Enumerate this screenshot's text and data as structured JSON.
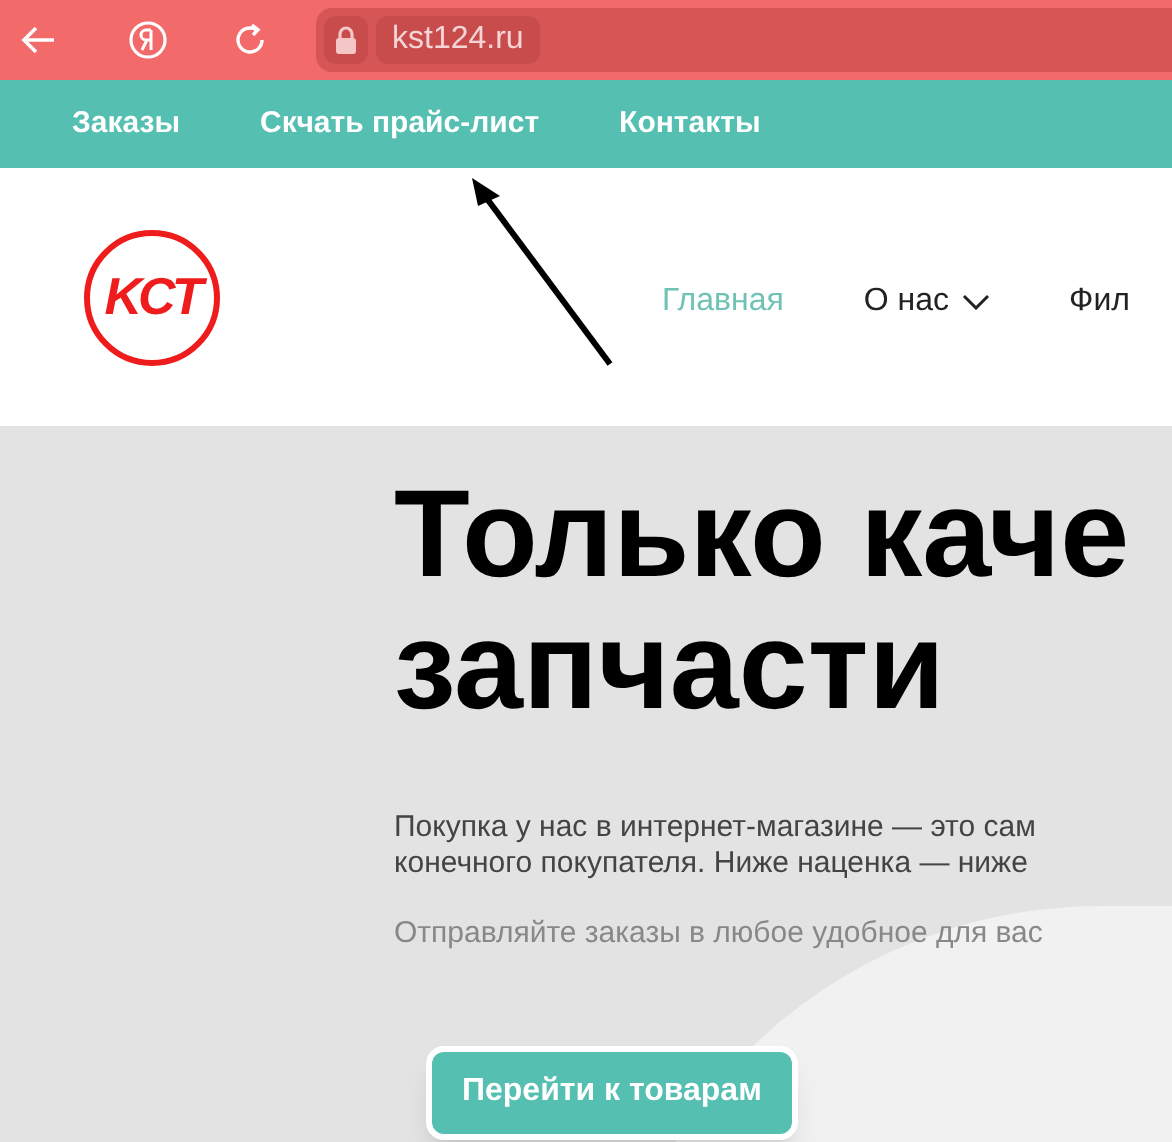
{
  "browser": {
    "url": "kst124.ru"
  },
  "top_nav": [
    "Заказы",
    "Скчать прайс-лист",
    "Контакты"
  ],
  "logo": {
    "text": "KCT"
  },
  "main_nav": [
    {
      "label": "Главная",
      "selected": true,
      "dropdown": false
    },
    {
      "label": "О нас",
      "selected": false,
      "dropdown": true
    },
    {
      "label": "Фил",
      "selected": false,
      "dropdown": false
    }
  ],
  "hero": {
    "heading": [
      "Только каче",
      "запчасти"
    ],
    "paragraph": [
      "Покупка у нас в интернет-магазине — это сам",
      "конечного покупателя. Ниже наценка — ниже"
    ],
    "note": "Отправляйте заказы в любое удобное для вас",
    "button": "Перейти к товарам"
  }
}
